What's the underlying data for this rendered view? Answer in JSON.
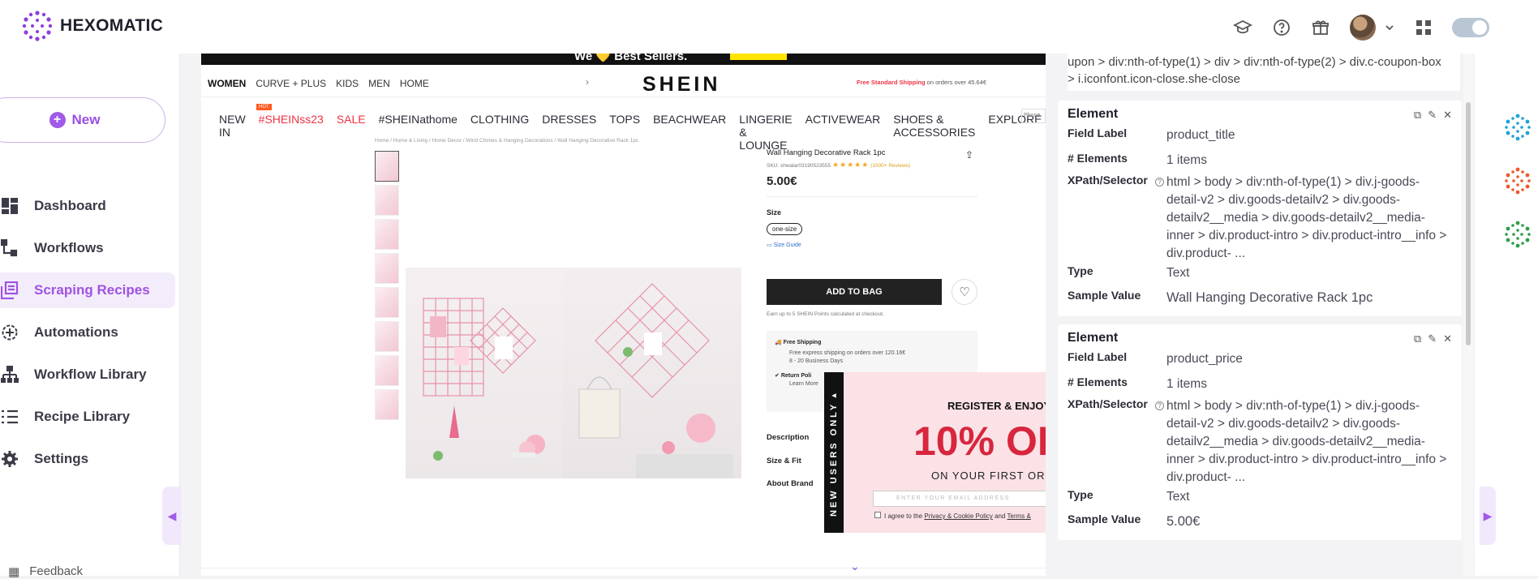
{
  "app": {
    "name": "HEXOMATIC"
  },
  "sidebar": {
    "new_label": "New",
    "items": [
      {
        "label": "Dashboard",
        "icon": "dashboard-icon"
      },
      {
        "label": "Workflows",
        "icon": "workflows-icon"
      },
      {
        "label": "Scraping Recipes",
        "icon": "scraping-recipes-icon",
        "active": true
      },
      {
        "label": "Automations",
        "icon": "automations-icon"
      },
      {
        "label": "Workflow Library",
        "icon": "workflow-library-icon"
      },
      {
        "label": "Recipe Library",
        "icon": "recipe-library-icon"
      },
      {
        "label": "Settings",
        "icon": "settings-icon"
      }
    ],
    "feedback_label": "Feedback"
  },
  "colors": {
    "accent": "#a052e4",
    "active_bg": "#f3edfb",
    "add_bag": "#222222",
    "popup_red": "#d7263d"
  },
  "page": {
    "top_promo": "We 💛 Best Sellers.",
    "nav1": [
      "WOMEN",
      "CURVE + PLUS",
      "KIDS",
      "MEN",
      "HOME"
    ],
    "brand": "SHEIN",
    "free_shipping_bold": "Free Standard Shipping",
    "free_shipping_rest": " on orders over 45.64€",
    "nav2": [
      "NEW IN",
      "#SHEINss23",
      "SALE",
      "#SHEINathome",
      "CLOTHING",
      "DRESSES",
      "TOPS",
      "BEACHWEAR",
      "LINGERIE & LOUNGE",
      "ACTIVEWEAR",
      "SHOES & ACCESSORIES",
      "EXPLORE"
    ],
    "hot_badge": "HOT",
    "phone_placeholder": "Phone",
    "breadcrumb": "Home / Home & Living / Home Decor / Wind Chimes & Hanging Decorations / Wall Hanging Decorative Rack 1pc",
    "product_title": "Wall Hanging Decorative Rack 1pc",
    "sku": "SKU: shwalar03190523555",
    "stars": "★★★★★",
    "reviews": "(1000+ Reviews)",
    "price": "5.00€",
    "size_label": "Size",
    "size_value": "one-size",
    "size_guide": "Size Guide",
    "add_to_bag": "ADD TO BAG",
    "earn_points": "Earn up to 5 SHEIN Points calculated at checkout.",
    "shipping_title": "Free Shipping",
    "shipping_line1": "Free express shipping on orders over 120.16€",
    "shipping_line2": "8 - 20 Business Days",
    "return_title": "Return Poli",
    "return_learn": "Learn More",
    "accordions": [
      "Description",
      "Size & Fit",
      "About Brand"
    ],
    "popup": {
      "side": "NEW USERS ONLY",
      "title": "REGISTER & ENJOY",
      "big": "10% OI",
      "sub": "ON YOUR FIRST OR",
      "email_placeholder": "ENTER YOUR EMAIL ADDRESS",
      "agree_prefix": "I agree to the ",
      "agree_link1": "Privacy & Cookie Policy",
      "agree_mid": " and ",
      "agree_link2": "Terms &"
    }
  },
  "panel": {
    "prev_selector": "upon > div:nth-of-type(1) > div > div:nth-of-type(2) > div.c-coupon-box > i.iconfont.icon-close.she-close",
    "cards": [
      {
        "heading": "Element",
        "field_label_key": "Field Label",
        "field_label": "product_title",
        "count_key": "# Elements",
        "count": "1 items",
        "selector_key": "XPath/Selector",
        "selector": "html > body > div:nth-of-type(1) > div.j-goods-detail-v2 > div.goods-detailv2 > div.goods-detailv2__media > div.goods-detailv2__media-inner > div.product-intro > div.product-intro__info > div.product- ...",
        "type_key": "Type",
        "type": "Text",
        "sample_key": "Sample Value",
        "sample": "Wall Hanging Decorative Rack 1pc"
      },
      {
        "heading": "Element",
        "field_label_key": "Field Label",
        "field_label": "product_price",
        "count_key": "# Elements",
        "count": "1 items",
        "selector_key": "XPath/Selector",
        "selector": "html > body > div:nth-of-type(1) > div.j-goods-detail-v2 > div.goods-detailv2 > div.goods-detailv2__media > div.goods-detailv2__media-inner > div.product-intro > div.product-intro__info > div.product- ...",
        "type_key": "Type",
        "type": "Text",
        "sample_key": "Sample Value",
        "sample": "5.00€"
      }
    ]
  }
}
